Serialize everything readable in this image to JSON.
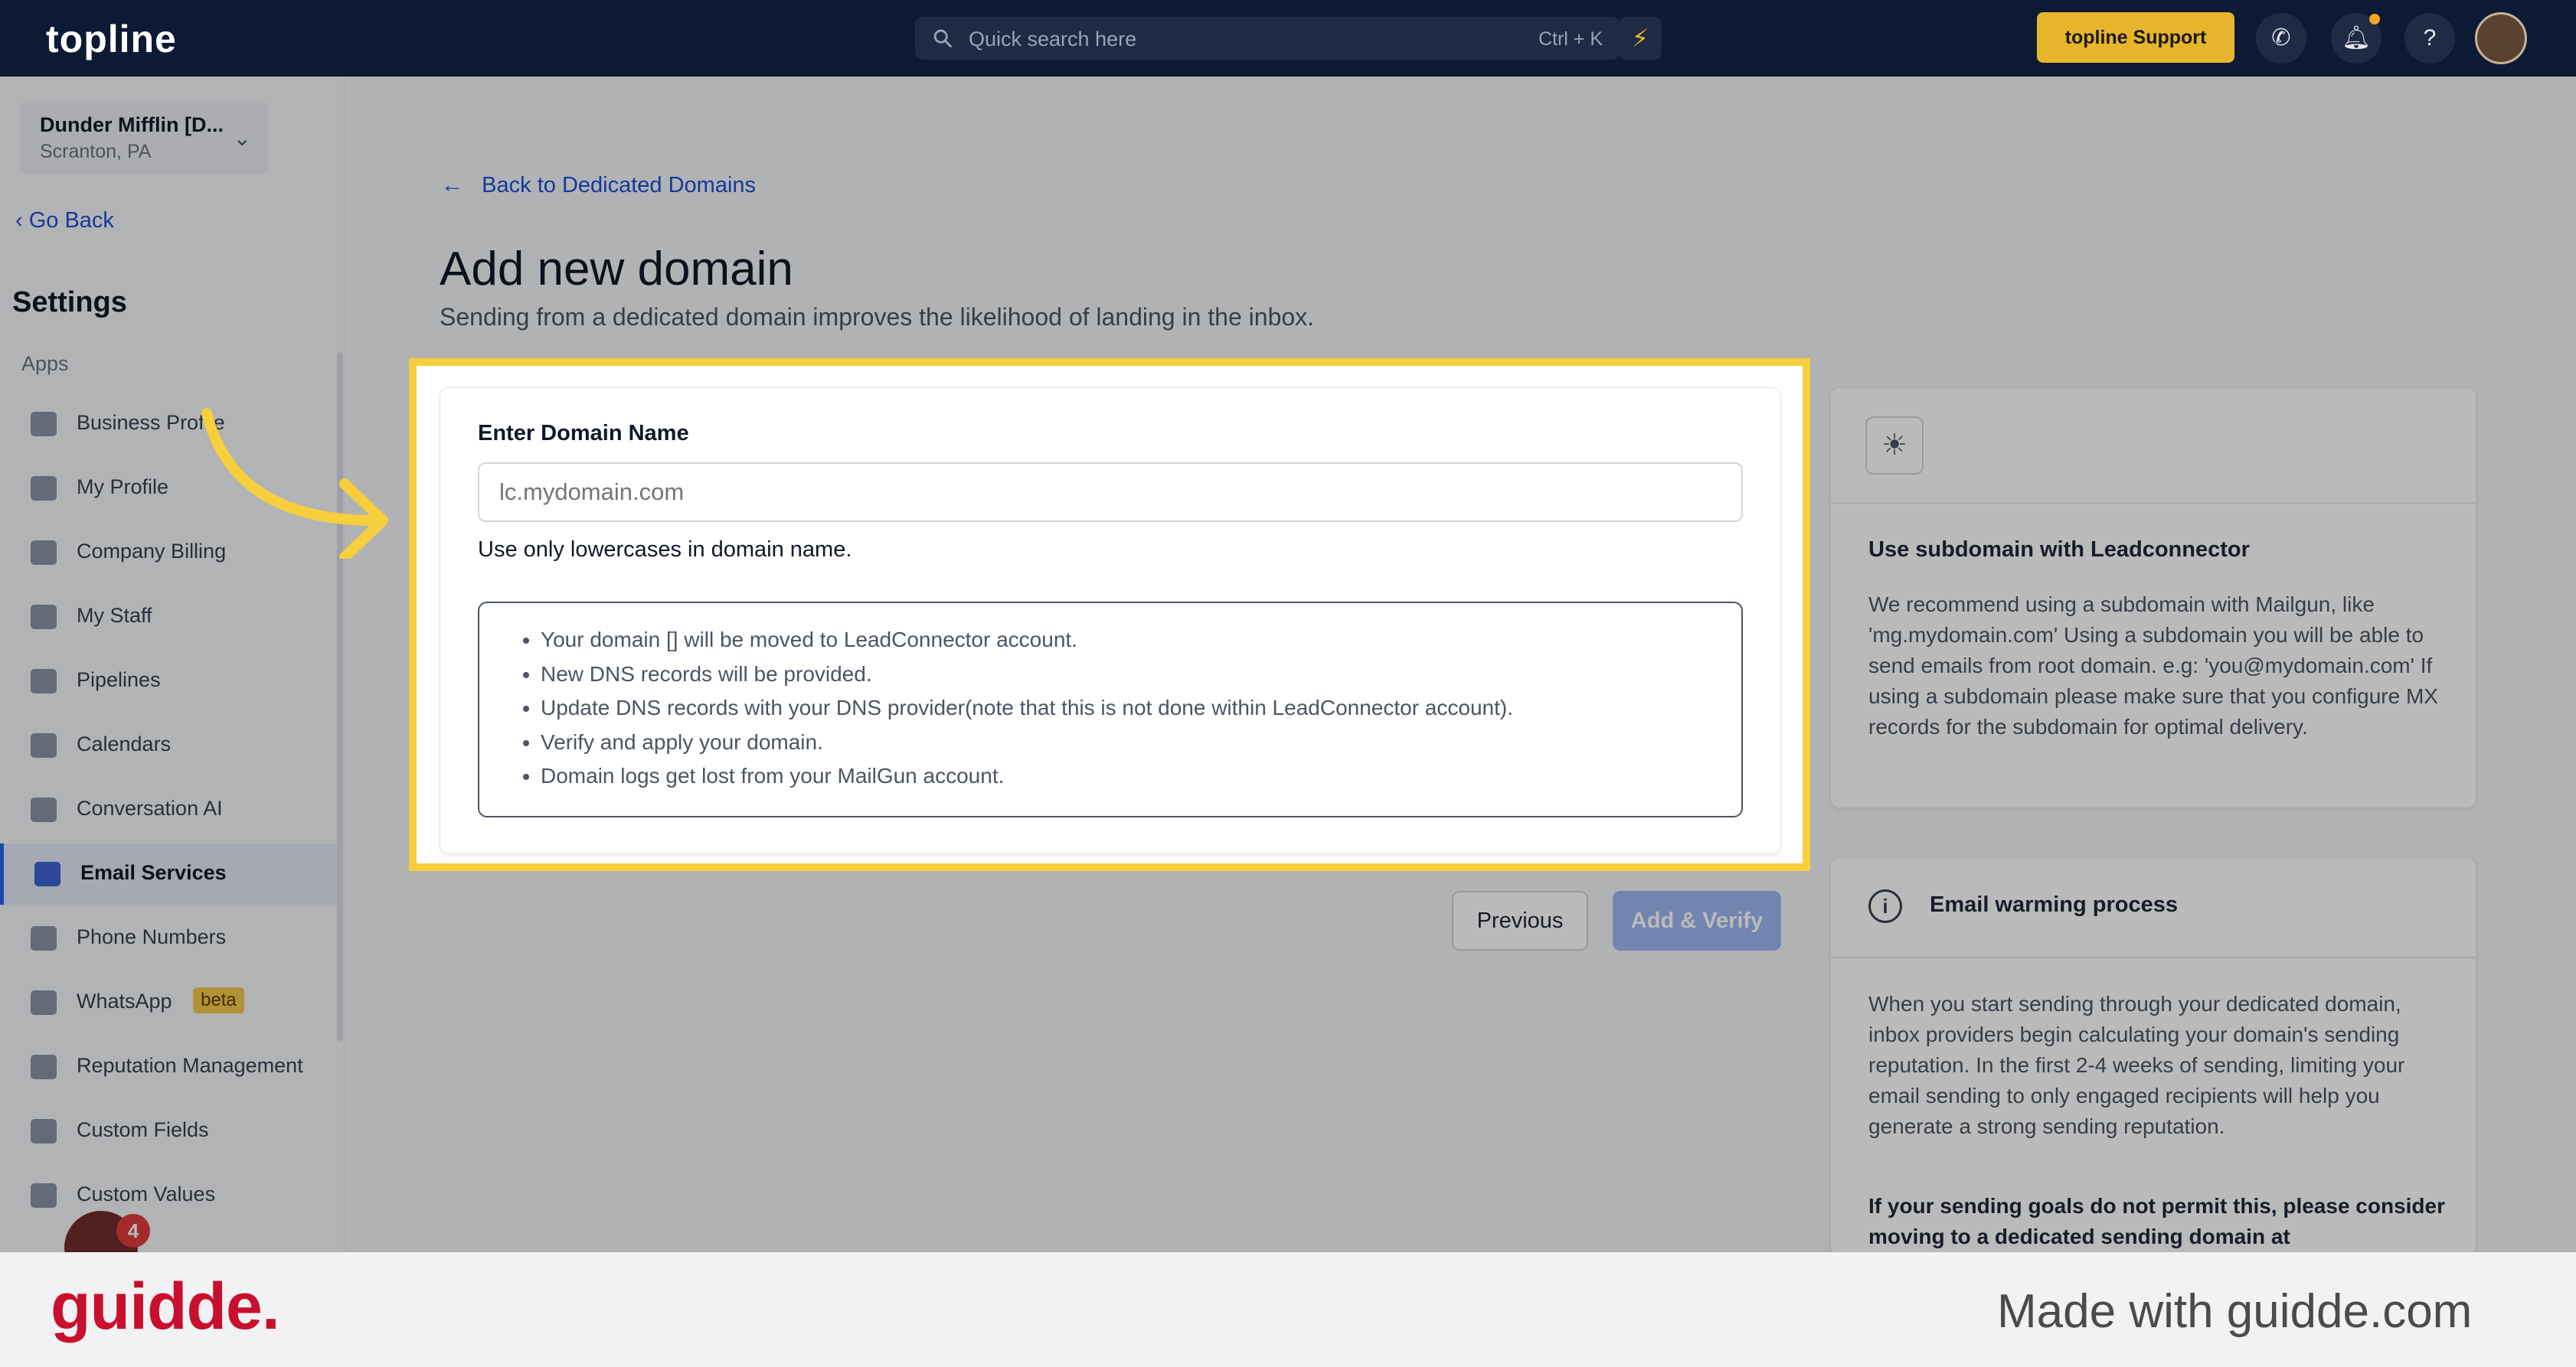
{
  "topbar": {
    "logo": "topline",
    "search_placeholder": "Quick search here",
    "search_shortcut": "Ctrl + K",
    "support_label": "topline Support",
    "icons": [
      "search-icon",
      "bolt-icon",
      "phone-icon",
      "bell-icon",
      "help-icon"
    ]
  },
  "sidebar": {
    "account_name": "Dunder Mifflin [D...",
    "account_location": "Scranton, PA",
    "go_back": "Go Back",
    "title": "Settings",
    "section": "Apps",
    "items": [
      {
        "label": "Business Profile"
      },
      {
        "label": "My Profile"
      },
      {
        "label": "Company Billing"
      },
      {
        "label": "My Staff"
      },
      {
        "label": "Pipelines"
      },
      {
        "label": "Calendars"
      },
      {
        "label": "Conversation AI"
      },
      {
        "label": "Email Services",
        "active": true
      },
      {
        "label": "Phone Numbers"
      },
      {
        "label": "WhatsApp",
        "badge": "beta"
      },
      {
        "label": "Reputation Management"
      },
      {
        "label": "Custom Fields"
      },
      {
        "label": "Custom Values"
      }
    ],
    "notification_count": "4"
  },
  "main": {
    "back_link": "Back to Dedicated Domains",
    "title": "Add new domain",
    "subtitle": "Sending from a dedicated domain improves the likelihood of landing in the inbox.",
    "field_label": "Enter Domain Name",
    "input_placeholder": "lc.mydomain.com",
    "hint": "Use only lowercases in domain name.",
    "notes": [
      "Your domain [] will be moved to LeadConnector account.",
      "New DNS records will be provided.",
      "Update DNS records with your DNS provider(note that this is not done within LeadConnector account).",
      "Verify and apply your domain.",
      "Domain logs get lost from your MailGun account."
    ],
    "previous_label": "Previous",
    "add_verify_label": "Add & Verify"
  },
  "tips": {
    "subdomain_title": "Use subdomain with Leadconnector",
    "subdomain_body": "We recommend using a subdomain with Mailgun, like 'mg.mydomain.com' Using a subdomain you will be able to send emails from root domain. e.g: 'you@mydomain.com' If using a subdomain please make sure that you configure MX records for the subdomain for optimal delivery.",
    "warming_title": "Email warming process",
    "warming_body": "When you start sending through your dedicated domain, inbox providers begin calculating your domain's sending reputation. In the first 2-4 weeks of sending, limiting your email sending to only engaged recipients will help you generate a strong sending reputation.",
    "warming_bold": "If your sending goals do not permit this, please consider moving to a dedicated sending domain at"
  },
  "footer": {
    "logo": "guidde.",
    "made_with": "Made with guidde.com"
  },
  "colors": {
    "topbar": "#0d1a33",
    "accent": "#1d4ed8",
    "highlight": "#f7cf3c",
    "support_button": "#e7b52c",
    "guidde_red": "#c8102e"
  }
}
